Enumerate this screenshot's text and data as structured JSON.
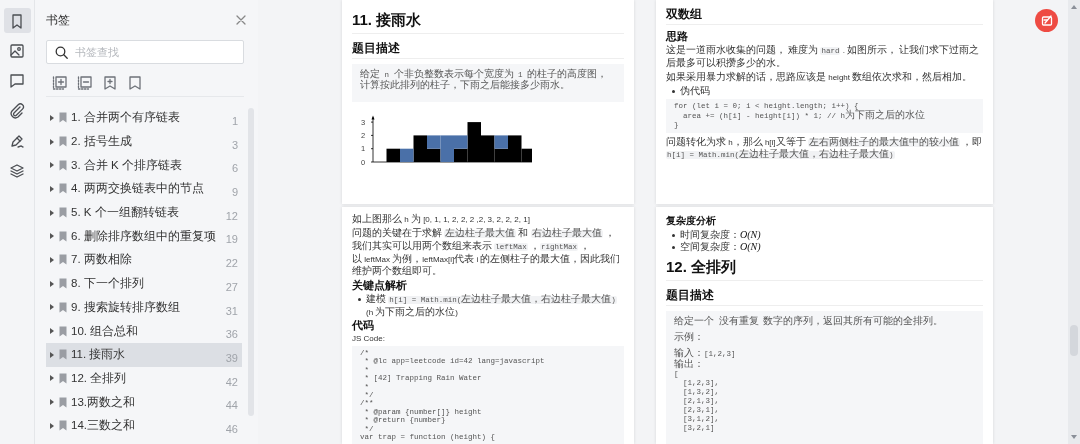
{
  "rail": [
    {
      "kind": "bookmark",
      "selected": true
    },
    {
      "kind": "image",
      "selected": false
    },
    {
      "kind": "comment",
      "selected": false
    },
    {
      "kind": "attachment",
      "selected": false
    },
    {
      "kind": "signature",
      "selected": false
    },
    {
      "kind": "layers",
      "selected": false
    }
  ],
  "sidebar": {
    "title": "书签",
    "search": {
      "placeholder": "书签查找"
    },
    "tools": [
      {
        "kind": "expand-all"
      },
      {
        "kind": "collapse-all"
      },
      {
        "kind": "add-bookmark"
      },
      {
        "kind": "bookmark"
      }
    ],
    "items": [
      {
        "label": "1. 合并两个有序链表",
        "page": "1",
        "selected": false,
        "expanded": false
      },
      {
        "label": "2. 括号生成",
        "page": "3",
        "selected": false,
        "expanded": false
      },
      {
        "label": "3. 合并 K 个排序链表",
        "page": "6",
        "selected": false,
        "expanded": false
      },
      {
        "label": "4. 两两交换链表中的节点",
        "page": "9",
        "selected": false,
        "expanded": false
      },
      {
        "label": "5. K 个一组翻转链表",
        "page": "12",
        "selected": false,
        "expanded": false
      },
      {
        "label": "6. 删除排序数组中的重复项",
        "page": "19",
        "selected": false,
        "expanded": false
      },
      {
        "label": "7. 两数相除",
        "page": "22",
        "selected": false,
        "expanded": false
      },
      {
        "label": "8. 下一个排列",
        "page": "27",
        "selected": false,
        "expanded": false
      },
      {
        "label": "9. 搜索旋转排序数组",
        "page": "31",
        "selected": false,
        "expanded": false
      },
      {
        "label": "10. 组合总和",
        "page": "36",
        "selected": false,
        "expanded": false
      },
      {
        "label": "11. 接雨水",
        "page": "39",
        "selected": true,
        "expanded": false
      },
      {
        "label": "12. 全排列",
        "page": "42",
        "selected": false,
        "expanded": false
      },
      {
        "label": "13.两数之和",
        "page": "44",
        "selected": false,
        "expanded": false
      },
      {
        "label": "14.三数之和",
        "page": "46",
        "selected": false,
        "expanded": false
      }
    ]
  },
  "pages": [
    {
      "blocks": [
        {
          "kind": "h1",
          "text": "11. 接雨水"
        },
        {
          "kind": "h2",
          "text": "题目描述"
        },
        {
          "kind": "box",
          "paragraphs": [
            [
              "给定 n 个非负整数表示每个宽度为 1 的柱子的高度图，计算按此排列的柱子，下雨之后能接多少雨水。"
            ]
          ]
        },
        {
          "kind": "chart",
          "chart_data": {
            "type": "bar",
            "stacked": true,
            "ylim": [
              0,
              3.5
            ],
            "yticks": [
              0,
              1,
              2,
              3
            ],
            "series": [
              {
                "color": "#000000",
                "values": [
                  0,
                  1,
                  0,
                  2,
                  1,
                  0,
                  1,
                  3,
                  2,
                  1,
                  2,
                  1
                ]
              },
              {
                "color": "#4a70a8",
                "values": [
                  0,
                  0,
                  1,
                  0,
                  1,
                  2,
                  1,
                  0,
                  0,
                  1,
                  0,
                  0
                ]
              }
            ]
          }
        }
      ]
    },
    {
      "blocks": [
        {
          "kind": "h2",
          "text": "双数组"
        },
        {
          "kind": "h3",
          "text": "思路"
        },
        {
          "kind": "p",
          "segments": [
            {
              "kind": "text",
              "text": "这是一道雨水收集的问题， 难度为 "
            },
            {
              "kind": "code",
              "text": "hard"
            },
            {
              "kind": "text",
              "text": " . 如图所示， 让我们求下过雨之后最多可以积攒多少的水。"
            }
          ]
        },
        {
          "kind": "p",
          "segments": [
            {
              "kind": "text",
              "text": "如果采用暴力求解的话，思路应该是 height 数组依次求和，然后相加。"
            }
          ]
        },
        {
          "kind": "bullets",
          "items": [
            {
              "segments": [
                {
                  "kind": "text",
                  "text": "伪代码"
                }
              ]
            }
          ]
        },
        {
          "kind": "code",
          "lines": [
            "for (let i = 0; i < height.length; i++) {",
            "  area += (h[i] - height[i]) * 1; // h为下雨之后的水位",
            "}"
          ]
        },
        {
          "kind": "p",
          "segments": [
            {
              "kind": "text",
              "text": "问题转化为求 h，那么 h[i]又等于 "
            },
            {
              "kind": "code",
              "text": "左右两侧柱子的最大值中的较小值"
            },
            {
              "kind": "text",
              "text": " ，即"
            },
            {
              "kind": "break"
            },
            {
              "kind": "code",
              "text": "h[i] = Math.min(左边柱子最大值，右边柱子最大值)"
            }
          ]
        }
      ]
    },
    {
      "blocks": [
        {
          "kind": "p",
          "segments": [
            {
              "kind": "text",
              "text": "如上图那么 h 为 [0, 1, 1, 2, 2, 2 ,2, 3, 2, 2, 2, 1]"
            }
          ]
        },
        {
          "kind": "p",
          "segments": [
            {
              "kind": "text",
              "text": "问题的关键在于求解 "
            },
            {
              "kind": "code",
              "text": "左边柱子最大值"
            },
            {
              "kind": "text",
              "text": " 和 "
            },
            {
              "kind": "code",
              "text": "右边柱子最大值"
            },
            {
              "kind": "text",
              "text": " ，"
            },
            {
              "kind": "break"
            },
            {
              "kind": "text",
              "text": "我们其实可以用两个数组来表示 "
            },
            {
              "kind": "code",
              "text": "leftMax"
            },
            {
              "kind": "text",
              "text": " ，"
            },
            {
              "kind": "code",
              "text": "rightMax"
            },
            {
              "kind": "text",
              "text": " ，"
            },
            {
              "kind": "break"
            },
            {
              "kind": "text",
              "text": "以 leftMax 为例，leftMax[i]代表 i 的左侧柱子的最大值，因此我们维护两个数组即可。"
            }
          ]
        },
        {
          "kind": "h3",
          "text": "关键点解析"
        },
        {
          "kind": "bullets",
          "items": [
            {
              "segments": [
                {
                  "kind": "text",
                  "text": "建模 "
                },
                {
                  "kind": "code",
                  "text": "h[i] = Math.min(左边柱子最大值，右边柱子最大值)"
                },
                {
                  "kind": "text",
                  "text": " (h 为下雨之后的水位)"
                }
              ]
            }
          ]
        },
        {
          "kind": "h3",
          "text": "代码"
        },
        {
          "kind": "p",
          "segments": [
            {
              "kind": "text",
              "text": "JS Code:"
            }
          ]
        },
        {
          "kind": "code",
          "lines": [
            "/*",
            " * @lc app=leetcode id=42 lang=javascript",
            " *",
            " * [42] Trapping Rain Water",
            " *",
            " */",
            "/**",
            " * @param {number[]} height",
            " * @return {number}",
            " */",
            "var trap = function (height) {"
          ]
        }
      ]
    },
    {
      "blocks": [
        {
          "kind": "h4",
          "text": "复杂度分析"
        },
        {
          "kind": "bullets",
          "items": [
            {
              "segments": [
                {
                  "kind": "rich",
                  "text": "时间复杂度：*O(N)*"
                }
              ]
            },
            {
              "segments": [
                {
                  "kind": "rich",
                  "text": "空间复杂度：*O(N)*"
                }
              ]
            }
          ]
        },
        {
          "kind": "h1",
          "text": "12. 全排列"
        },
        {
          "kind": "h2",
          "text": "题目描述"
        },
        {
          "kind": "box",
          "paragraphs": [
            [
              "给定一个 没有重复 数字的序列，返回其所有可能的全排列。"
            ],
            [
              "示例："
            ],
            [
              "输入：[1,2,3]",
              "输出：",
              "[",
              "  [1,2,3],",
              "  [1,3,2],",
              "  [2,1,3],",
              "  [2,3,1],",
              "  [3,1,2],",
              "  [3,2,1]"
            ]
          ]
        }
      ]
    }
  ],
  "fab": {
    "kind": "edit"
  }
}
